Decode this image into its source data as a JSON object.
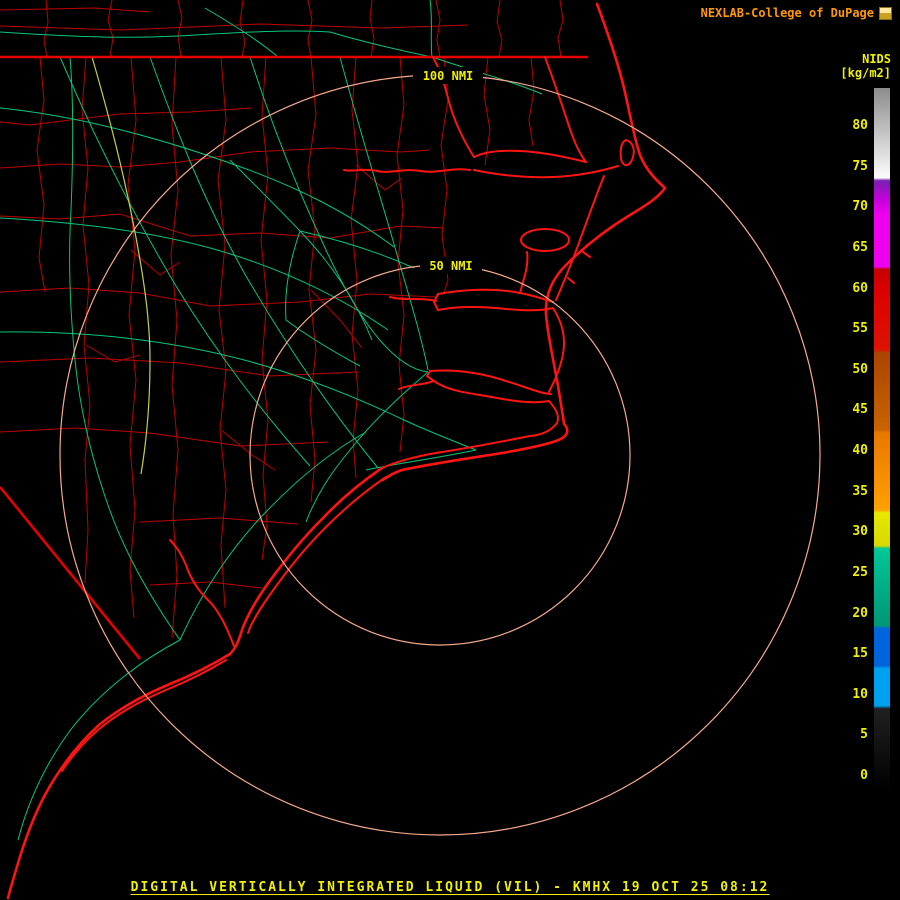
{
  "header": {
    "brand": "NEXLAB-College of DuPage",
    "logo_icon": "cod-logo-icon"
  },
  "colorbar": {
    "title": "NIDS",
    "units": "[kg/m2]",
    "ticks": [
      "80",
      "75",
      "70",
      "65",
      "60",
      "55",
      "50",
      "45",
      "40",
      "35",
      "30",
      "25",
      "20",
      "15",
      "10",
      "5",
      "0"
    ],
    "gradient_stops": [
      "#8C8C8C 0%",
      "#FCFCFC 12.8%",
      "#7A1FB4 13.2%",
      "#C800DC 16%",
      "#EE00EE 18%",
      "#EE00EE 25.5%",
      "#C40000 25.8%",
      "#DC0000 28.8%",
      "#DC1400 37.3%",
      "#AA4400 37.7%",
      "#C86400 48.7%",
      "#E87800 49.1%",
      "#FFA000 60.1%",
      "#E8E800 60.5%",
      "#D8D800 65.2%",
      "#00C896 65.6%",
      "#009678 76.6%",
      "#0064DC 77.0%",
      "#0064DC 82.3%",
      "#00A0F0 82.7%",
      "#00A0F0 88.0%",
      "#202020 88.4%",
      "#000000 100%"
    ]
  },
  "map": {
    "range_ring_labels": {
      "outer": "100 NMI",
      "inner": "50 NMI"
    }
  },
  "footer": {
    "product_title": "DIGITAL VERTICALLY INTEGRATED LIQUID (VIL) - KMHX 19 OCT 25 08:12"
  },
  "colors": {
    "background": "#000000",
    "brand_text": "#FF9900",
    "label_text": "#F0F000",
    "tick_text": "#F0F000",
    "footer_text": "#F0F000",
    "county_line": "#BE0000",
    "state_line": "#E60000",
    "coastline": "#FF1414",
    "road_major": "#00C87D",
    "road_secondary": "#C6D23E",
    "range_ring": "#F5AA8C",
    "ring_label": "#F0F000"
  }
}
